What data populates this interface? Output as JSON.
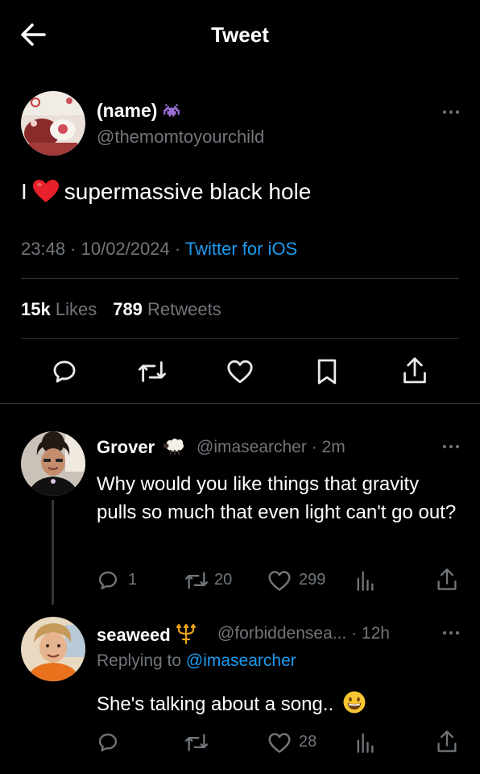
{
  "header": {
    "title": "Tweet"
  },
  "main_tweet": {
    "name": "(name)",
    "handle": "@themomtoyourchild",
    "text_prefix": "I",
    "text_suffix": "supermassive black hole",
    "timestamp": "23:48 · 10/02/2024 · ",
    "client": "Twitter for iOS",
    "likes_count": "15k",
    "likes_label": "Likes",
    "retweets_count": "789",
    "retweets_label": "Retweets"
  },
  "replies": [
    {
      "name": "Grover",
      "handle": "@imasearcher · 2m",
      "text": "Why would you like things that gravity pulls so much that even light can't go out?",
      "reply_count": "1",
      "retweet_count": "20",
      "like_count": "299"
    },
    {
      "name": "seaweed",
      "handle": "@forbiddensea... · 12h",
      "replying_prefix": "Replying to ",
      "replying_to": "@imasearcher",
      "text": "She's talking about a song..",
      "like_count": "28"
    }
  ],
  "colors": {
    "background": "#000000",
    "text": "#e7e9ea",
    "muted": "#71767b",
    "accent": "#1d9bf0",
    "divider": "#2f3336"
  },
  "icons": [
    "back-arrow-icon",
    "space-invader-icon",
    "heart-emoji-icon",
    "reply-icon",
    "retweet-icon",
    "like-icon",
    "bookmark-icon",
    "share-icon",
    "views-icon",
    "sheep-emoji-icon",
    "trident-emoji-icon",
    "grinning-emoji-icon",
    "more-icon"
  ]
}
